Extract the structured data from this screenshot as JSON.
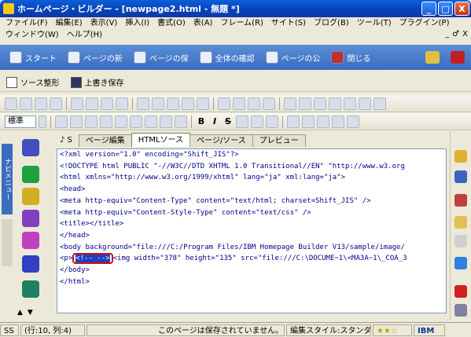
{
  "window": {
    "title": "ホームページ・ビルダー - [newpage2.html - 無題 *]",
    "minimize": "_",
    "maximize": "□",
    "close": "X"
  },
  "menu": {
    "items": [
      "ファイル(F)",
      "編集(E)",
      "表示(V)",
      "挿入(I)",
      "書式(O)",
      "表(A)",
      "フレーム(R)",
      "サイト(S)",
      "ブログ(B)",
      "ツール(T)",
      "プラグイン(P)",
      "ウィンドウ(W)",
      "ヘルプ(H)"
    ],
    "mdi_min": "_",
    "mdi_restore": "♂",
    "mdi_close": "X"
  },
  "nav": {
    "items": [
      "スタート",
      "ページの新",
      "ページの保",
      "全体の確認",
      "ページの公",
      "閉じる"
    ]
  },
  "source_toolbar": {
    "source_format": "ソース整形",
    "overwrite_save": "上書き保存"
  },
  "format_toolbar": {
    "style_select": "標準"
  },
  "sidebar": {
    "tab_label": "ナビメニュー"
  },
  "editor": {
    "tabs": [
      "ページ編集",
      "HTMLソース",
      "ページ/ソース",
      "プレビュー"
    ],
    "tab_icon": "♪ S",
    "lines": [
      "<?xml version=\"1.0\" encoding=\"Shift_JIS\"?>",
      "<!DOCTYPE html PUBLIC \"-//W3C//DTD XHTML 1.0 Transitional//EN\" \"http://www.w3.org",
      "<html xmlns=\"http://www.w3.org/1999/xhtml\" lang=\"ja\" xml:lang=\"ja\">",
      "<head>",
      "<meta http-equiv=\"Content-Type\" content=\"text/html; charset=Shift_JIS\" />",
      "<meta http-equiv=\"Content-Style-Type\" content=\"text/css\" />",
      "<title></title>",
      "</head>",
      "<body background=\"file:///C:/Program Files/IBM Homepage Builder V13/sample/image/",
      "<p>",
      "</body>",
      "</html>"
    ],
    "line10_highlight": "<!-- -->",
    "line10_rest": "<img width=\"378\" height=\"135\" src=\"file:///C:\\DOCUME~1\\<MA3A~1\\_COA_3"
  },
  "status": {
    "mode": "SS",
    "position": "(行:10, 列:4)",
    "message": "このページは保存されていません。",
    "style": "編集スタイル:スタンダード",
    "stars": "★★☆",
    "brand": "IBM"
  }
}
